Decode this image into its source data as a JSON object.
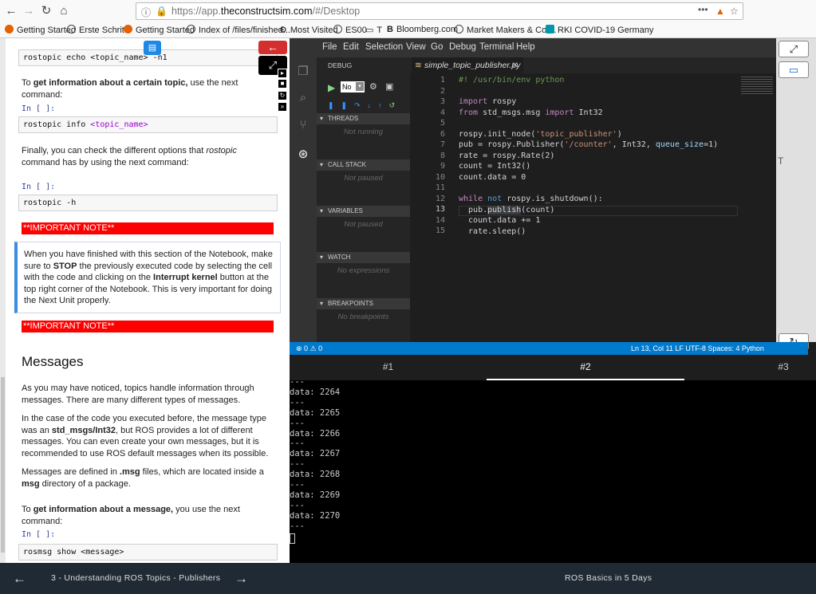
{
  "browser": {
    "url_prefix": "https://app.",
    "url_domain": "theconstructsim.com",
    "url_suffix": "/#/Desktop",
    "bookmarks": [
      "Getting Started",
      "Erste Schritte",
      "Getting Started",
      "Index of /files/finished...",
      "Most Visited",
      "ES00",
      "T",
      "Bloomberg.com",
      "Market Makers & Cor...",
      "RKI COVID-19 Germany"
    ]
  },
  "notebook": {
    "cell1": "rostopic echo <topic_name> -n1",
    "p1_pre": "To ",
    "p1_bold": "get information about a certain topic,",
    "p1_post": " use the next command:",
    "prompt": "In [ ]:",
    "cell2_cmd": "rostopic info ",
    "cell2_arg": "<topic_name>",
    "p2_a": "Finally, you can check the different options that ",
    "p2_i": "rostopic",
    "p2_b": " command has by using the next command:",
    "cell3": "rostopic -h",
    "important": "**IMPORTANT NOTE**",
    "note_a": "When you have finished with this section of the Notebook, make sure to ",
    "note_stop": "STOP",
    "note_b": " the previously executed code by selecting the cell with the code and clicking on the ",
    "note_kernel": "Interrupt kernel",
    "note_c": " button at the top right corner of the Notebook. This is very important for doing the Next Unit properly.",
    "heading": "Messages",
    "m1": "As you may have noticed, topics handle information through messages. There are many different types of messages.",
    "m2_a": "In the case of the code you executed before, the message type was an ",
    "m2_b": "std_msgs/Int32",
    "m2_c": ", but ROS provides a lot of different messages. You can even create your own messages, but it is recommended to use ROS default messages when its possible.",
    "m3_a": "Messages are defined in ",
    "m3_b": ".msg",
    "m3_c": " files, which are located inside a ",
    "m3_d": "msg",
    "m3_e": " directory of a package.",
    "m4_pre": "To ",
    "m4_bold": "get information about a message,",
    "m4_post": " you use the next command:",
    "cell4": "rosmsg show <message>"
  },
  "ide": {
    "menu": [
      "File",
      "Edit",
      "Selection",
      "View",
      "Go",
      "Debug",
      "Terminal",
      "Help"
    ],
    "debug_title": "DEBUG",
    "debug_config": "No",
    "sections": [
      {
        "title": "THREADS",
        "body": "Not running"
      },
      {
        "title": "CALL STACK",
        "body": "Not paused"
      },
      {
        "title": "VARIABLES",
        "body": "Not paused"
      },
      {
        "title": "WATCH",
        "body": "No expressions"
      },
      {
        "title": "BREAKPOINTS",
        "body": "No breakpoints"
      }
    ],
    "tab": "simple_topic_publisher.py",
    "line_numbers": [
      "1",
      "2",
      "3",
      "4",
      "5",
      "6",
      "7",
      "8",
      "9",
      "10",
      "11",
      "12",
      "13",
      "14",
      "15"
    ],
    "status_left": "⊗ 0 ⚠ 0",
    "status_right": "Ln 13, Col 11    LF    UTF-8    Spaces: 4    Python",
    "t_marker": "T"
  },
  "terminal": {
    "tabs": [
      "#1",
      "#2",
      "#3"
    ],
    "lines": [
      "---",
      "data: 2264",
      "---",
      "data: 2265",
      "---",
      "data: 2266",
      "---",
      "data: 2267",
      "---",
      "data: 2268",
      "---",
      "data: 2269",
      "---",
      "data: 2270",
      "---"
    ]
  },
  "footer": {
    "unit": "3 - Understanding ROS Topics - Publishers",
    "course": "ROS Basics in 5 Days"
  }
}
